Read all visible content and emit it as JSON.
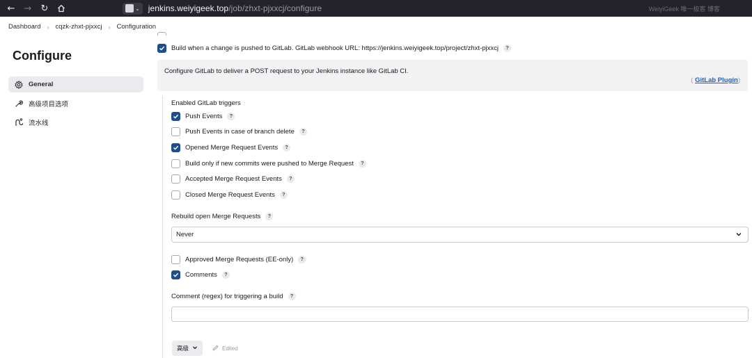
{
  "browser": {
    "url_host": "jenkins.weiyigeek.top",
    "url_path": "/job/zhxt-pjxxcj/configure",
    "watermark": "WeiyiGeek 唯一极客 博客"
  },
  "breadcrumb": [
    "Dashboard",
    "cqzk-zhxt-pjxxcj",
    "Configuration"
  ],
  "sidebar": {
    "title": "Configure",
    "items": [
      {
        "label": "General",
        "active": true
      },
      {
        "label": "高级项目选项",
        "active": false
      },
      {
        "label": "流水线",
        "active": false
      }
    ]
  },
  "main": {
    "build_trigger": {
      "label": "Build when a change is pushed to GitLab. GitLab webhook URL: https://jenkins.weiyigeek.top/project/zhxt-pjxxcj",
      "checked": true
    },
    "info_box": {
      "text": "Configure GitLab to deliver a POST request to your Jenkins instance like GitLab CI.",
      "plugin_prefix": "(",
      "plugin_link": "GitLab Plugin",
      "plugin_suffix": ")"
    },
    "triggers_heading": "Enabled GitLab triggers",
    "triggers": [
      {
        "label": "Push Events",
        "checked": true
      },
      {
        "label": "Push Events in case of branch delete",
        "checked": false
      },
      {
        "label": "Opened Merge Request Events",
        "checked": true
      },
      {
        "label": "Build only if new commits were pushed to Merge Request",
        "checked": false
      },
      {
        "label": "Accepted Merge Request Events",
        "checked": false
      },
      {
        "label": "Closed Merge Request Events",
        "checked": false
      }
    ],
    "rebuild_label": "Rebuild open Merge Requests",
    "rebuild_value": "Never",
    "extra_options": [
      {
        "label": "Approved Merge Requests (EE-only)",
        "checked": false
      },
      {
        "label": "Comments",
        "checked": true
      }
    ],
    "comment_regex_label": "Comment (regex) for triggering a build",
    "comment_regex_value": "",
    "advanced_label": "高级",
    "edited_label": "Edited"
  },
  "help_glyph": "?"
}
